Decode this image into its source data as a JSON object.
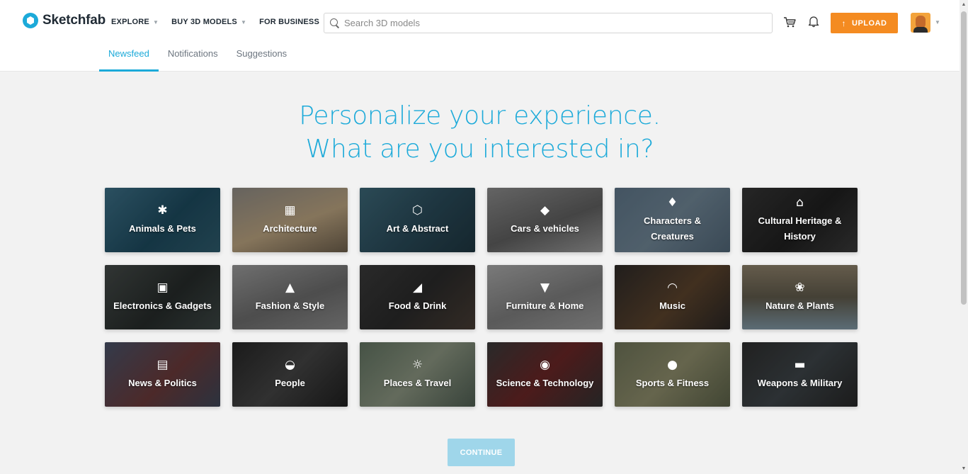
{
  "brand": {
    "name": "Sketchfab",
    "accent": "#1caad9",
    "upload_color": "#f48b21"
  },
  "nav": {
    "explore": "EXPLORE",
    "buy": "BUY 3D MODELS",
    "business": "FOR BUSINESS"
  },
  "search": {
    "placeholder": "Search 3D models"
  },
  "actions": {
    "upload": "UPLOAD",
    "icons": [
      "cart-icon",
      "bell-icon"
    ]
  },
  "tabs": [
    "Newsfeed",
    "Notifications",
    "Suggestions"
  ],
  "active_tab": "Newsfeed",
  "heading": {
    "line1": "Personalize your experience.",
    "line2": "What are you interested in?"
  },
  "categories": [
    {
      "label": "Animals & Pets",
      "icon": "bug-icon",
      "glyph": "✱",
      "bg": "linear-gradient(135deg,#3c6f86,#1d4a5e 55%,#2e5b6c)"
    },
    {
      "label": "Architecture",
      "icon": "building-icon",
      "glyph": "▦",
      "bg": "linear-gradient(160deg,#8e8a84,#b9a27f 55%,#6d5f4c)"
    },
    {
      "label": "Art & Abstract",
      "icon": "abstract-icon",
      "glyph": "⬡",
      "bg": "linear-gradient(135deg,#3c6777,#2a4b5a 50%,#1e3640)"
    },
    {
      "label": "Cars & vehicles",
      "icon": "car-icon",
      "glyph": "◆",
      "bg": "linear-gradient(160deg,#8b8b8b,#5f5f5f 55%,#9a9a9a)"
    },
    {
      "label": "Characters & Creatures",
      "icon": "character-icon",
      "glyph": "♦",
      "bg": "linear-gradient(135deg,#5e7588,#6f8595 50%,#516677)"
    },
    {
      "label": "Cultural Heritage & History",
      "icon": "museum-icon",
      "glyph": "⌂",
      "bg": "linear-gradient(135deg,#353535,#1f1f1f 55%,#3a3a3a)"
    },
    {
      "label": "Electronics & Gadgets",
      "icon": "chip-icon",
      "glyph": "▣",
      "bg": "linear-gradient(135deg,#444a48,#262b2a 55%,#3c4644)"
    },
    {
      "label": "Fashion & Style",
      "icon": "heel-icon",
      "glyph": "▲",
      "bg": "linear-gradient(160deg,#9a9a9a,#6b6b6b 55%,#8c8c8c)"
    },
    {
      "label": "Food & Drink",
      "icon": "pizza-icon",
      "glyph": "◢",
      "bg": "linear-gradient(135deg,#3a3a3a,#2a2a2a 50%,#473c34)"
    },
    {
      "label": "Furniture & Home",
      "icon": "lamp-icon",
      "glyph": "▼",
      "bg": "linear-gradient(160deg,#a9a9a9,#7d7d7d 55%,#9c9c9c)"
    },
    {
      "label": "Music",
      "icon": "headphones-icon",
      "glyph": "◠",
      "bg": "linear-gradient(135deg,#2e2a28,#5b432c 55%,#2a2624)"
    },
    {
      "label": "Nature & Plants",
      "icon": "flower-icon",
      "glyph": "❀",
      "bg": "linear-gradient(180deg,#8c7f69,#5f5a4b 50%,#7f96a3)"
    },
    {
      "label": "News & Politics",
      "icon": "newspaper-icon",
      "glyph": "▤",
      "bg": "linear-gradient(135deg,#485268,#6a3a3a 55%,#3d4657)"
    },
    {
      "label": "People",
      "icon": "sunglasses-icon",
      "glyph": "◒",
      "bg": "linear-gradient(135deg,#262626,#444 50%,#1f1f1f)"
    },
    {
      "label": "Places & Travel",
      "icon": "sun-icon",
      "glyph": "☼",
      "bg": "linear-gradient(135deg,#617361,#8a9480 50%,#4f5e52)"
    },
    {
      "label": "Science & Technology",
      "icon": "compass-icon",
      "glyph": "◉",
      "bg": "linear-gradient(135deg,#3a3a3a,#6a2626 50%,#333)"
    },
    {
      "label": "Sports & Fitness",
      "icon": "ball-icon",
      "glyph": "●",
      "bg": "linear-gradient(135deg,#6e7358,#8d8c6b 50%,#5b6148)"
    },
    {
      "label": "Weapons & Military",
      "icon": "tank-icon",
      "glyph": "▬",
      "bg": "linear-gradient(135deg,#2e2e2e,#3d4448 50%,#272727)"
    }
  ],
  "continue": "CONTINUE"
}
